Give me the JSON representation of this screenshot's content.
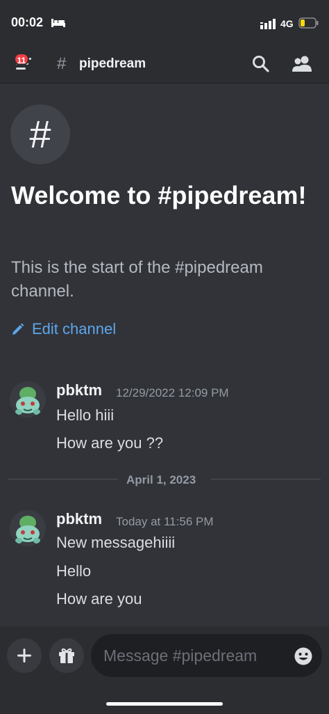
{
  "status_bar": {
    "time": "00:02",
    "network": "4G"
  },
  "header": {
    "unread_badge": "11",
    "hash_symbol": "#",
    "channel_name": "pipedream"
  },
  "welcome": {
    "avatar_symbol": "#",
    "title": "Welcome to #pipedream!",
    "description": "This is the start of the #pipedream channel.",
    "edit_label": "Edit channel"
  },
  "messages": [
    {
      "author": "pbktm",
      "timestamp": "12/29/2022 12:09 PM",
      "lines": [
        "Hello hiii",
        "How are you ??"
      ]
    },
    {
      "author": "pbktm",
      "timestamp": "Today at 11:56 PM",
      "lines": [
        "New messagehiiii",
        "Hello",
        "How are you"
      ]
    }
  ],
  "date_divider": "April 1, 2023",
  "composer": {
    "placeholder": "Message #pipedream"
  },
  "colors": {
    "background": "#313338",
    "header": "#2b2d31",
    "accent_link": "#5ea6ec",
    "badge": "#f23f43"
  },
  "icons": [
    "bed-icon",
    "signal-icon",
    "battery-icon",
    "menu-icon",
    "search-icon",
    "members-icon",
    "pencil-icon",
    "bulbasaur-avatar",
    "plus-icon",
    "gift-icon",
    "emoji-icon"
  ]
}
